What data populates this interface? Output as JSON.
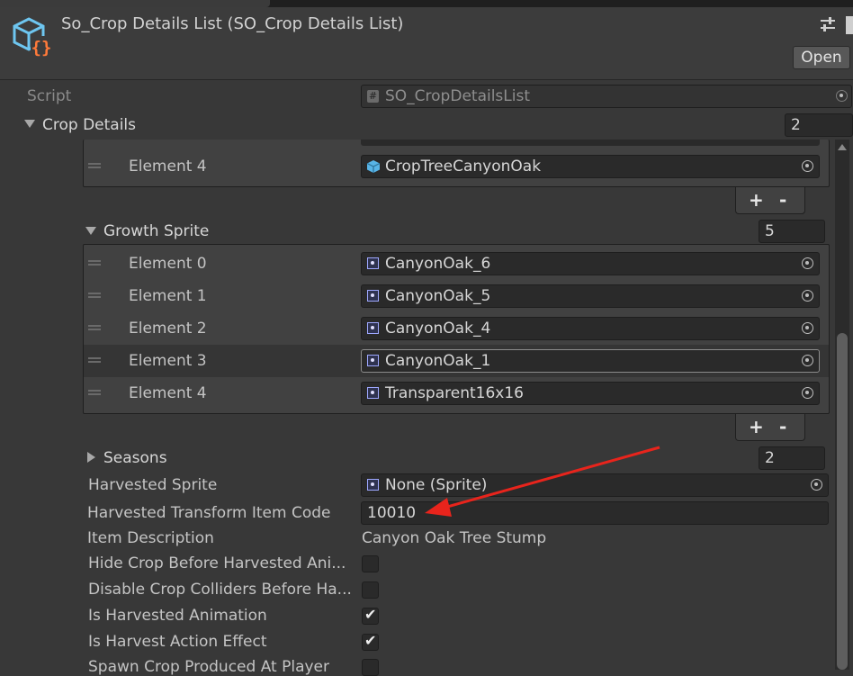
{
  "header": {
    "title": "So_Crop Details List (SO_Crop Details List)",
    "open_label": "Open",
    "icons": [
      "script-object-icon",
      "settings-sliders-icon"
    ]
  },
  "script": {
    "label": "Script",
    "value": "SO_CropDetailsList"
  },
  "crop_details": {
    "label": "Crop Details",
    "size": "2"
  },
  "prev_list": {
    "element4_label": "Element 4",
    "element4_value": "CropTreeCanyonOak"
  },
  "growth_sprite": {
    "label": "Growth Sprite",
    "size": "5",
    "items": [
      {
        "label": "Element 0",
        "value": "CanyonOak_6"
      },
      {
        "label": "Element 1",
        "value": "CanyonOak_5"
      },
      {
        "label": "Element 2",
        "value": "CanyonOak_4"
      },
      {
        "label": "Element 3",
        "value": "CanyonOak_1"
      },
      {
        "label": "Element 4",
        "value": "Transparent16x16"
      }
    ]
  },
  "list_controls": {
    "plus": "+",
    "minus": "-"
  },
  "seasons": {
    "label": "Seasons",
    "size": "2"
  },
  "fields": {
    "harvested_sprite_label": "Harvested Sprite",
    "harvested_sprite_value": "None (Sprite)",
    "harvested_transform_label": "Harvested Transform Item Code",
    "harvested_transform_value": "10010",
    "item_description_label": "Item Description",
    "item_description_value": "Canyon Oak Tree Stump",
    "hide_crop_label": "Hide Crop Before Harvested Ani...",
    "disable_colliders_label": "Disable Crop Colliders Before Ha...",
    "is_harvested_animation_label": "Is Harvested Animation",
    "is_harvest_action_effect_label": "Is Harvest Action Effect",
    "spawn_crop_label": "Spawn Crop Produced At Player"
  },
  "checkbox_states": {
    "hide_crop": false,
    "disable_colliders": false,
    "is_harvested_animation": true,
    "is_harvest_action_effect": true,
    "spawn_crop": false
  },
  "colors": {
    "background": "#383838",
    "field": "#2a2a2a",
    "annotation_arrow": "#e8241c",
    "sprite_icon": "#9ea8ff",
    "prefab_icon": "#58b4e6"
  }
}
